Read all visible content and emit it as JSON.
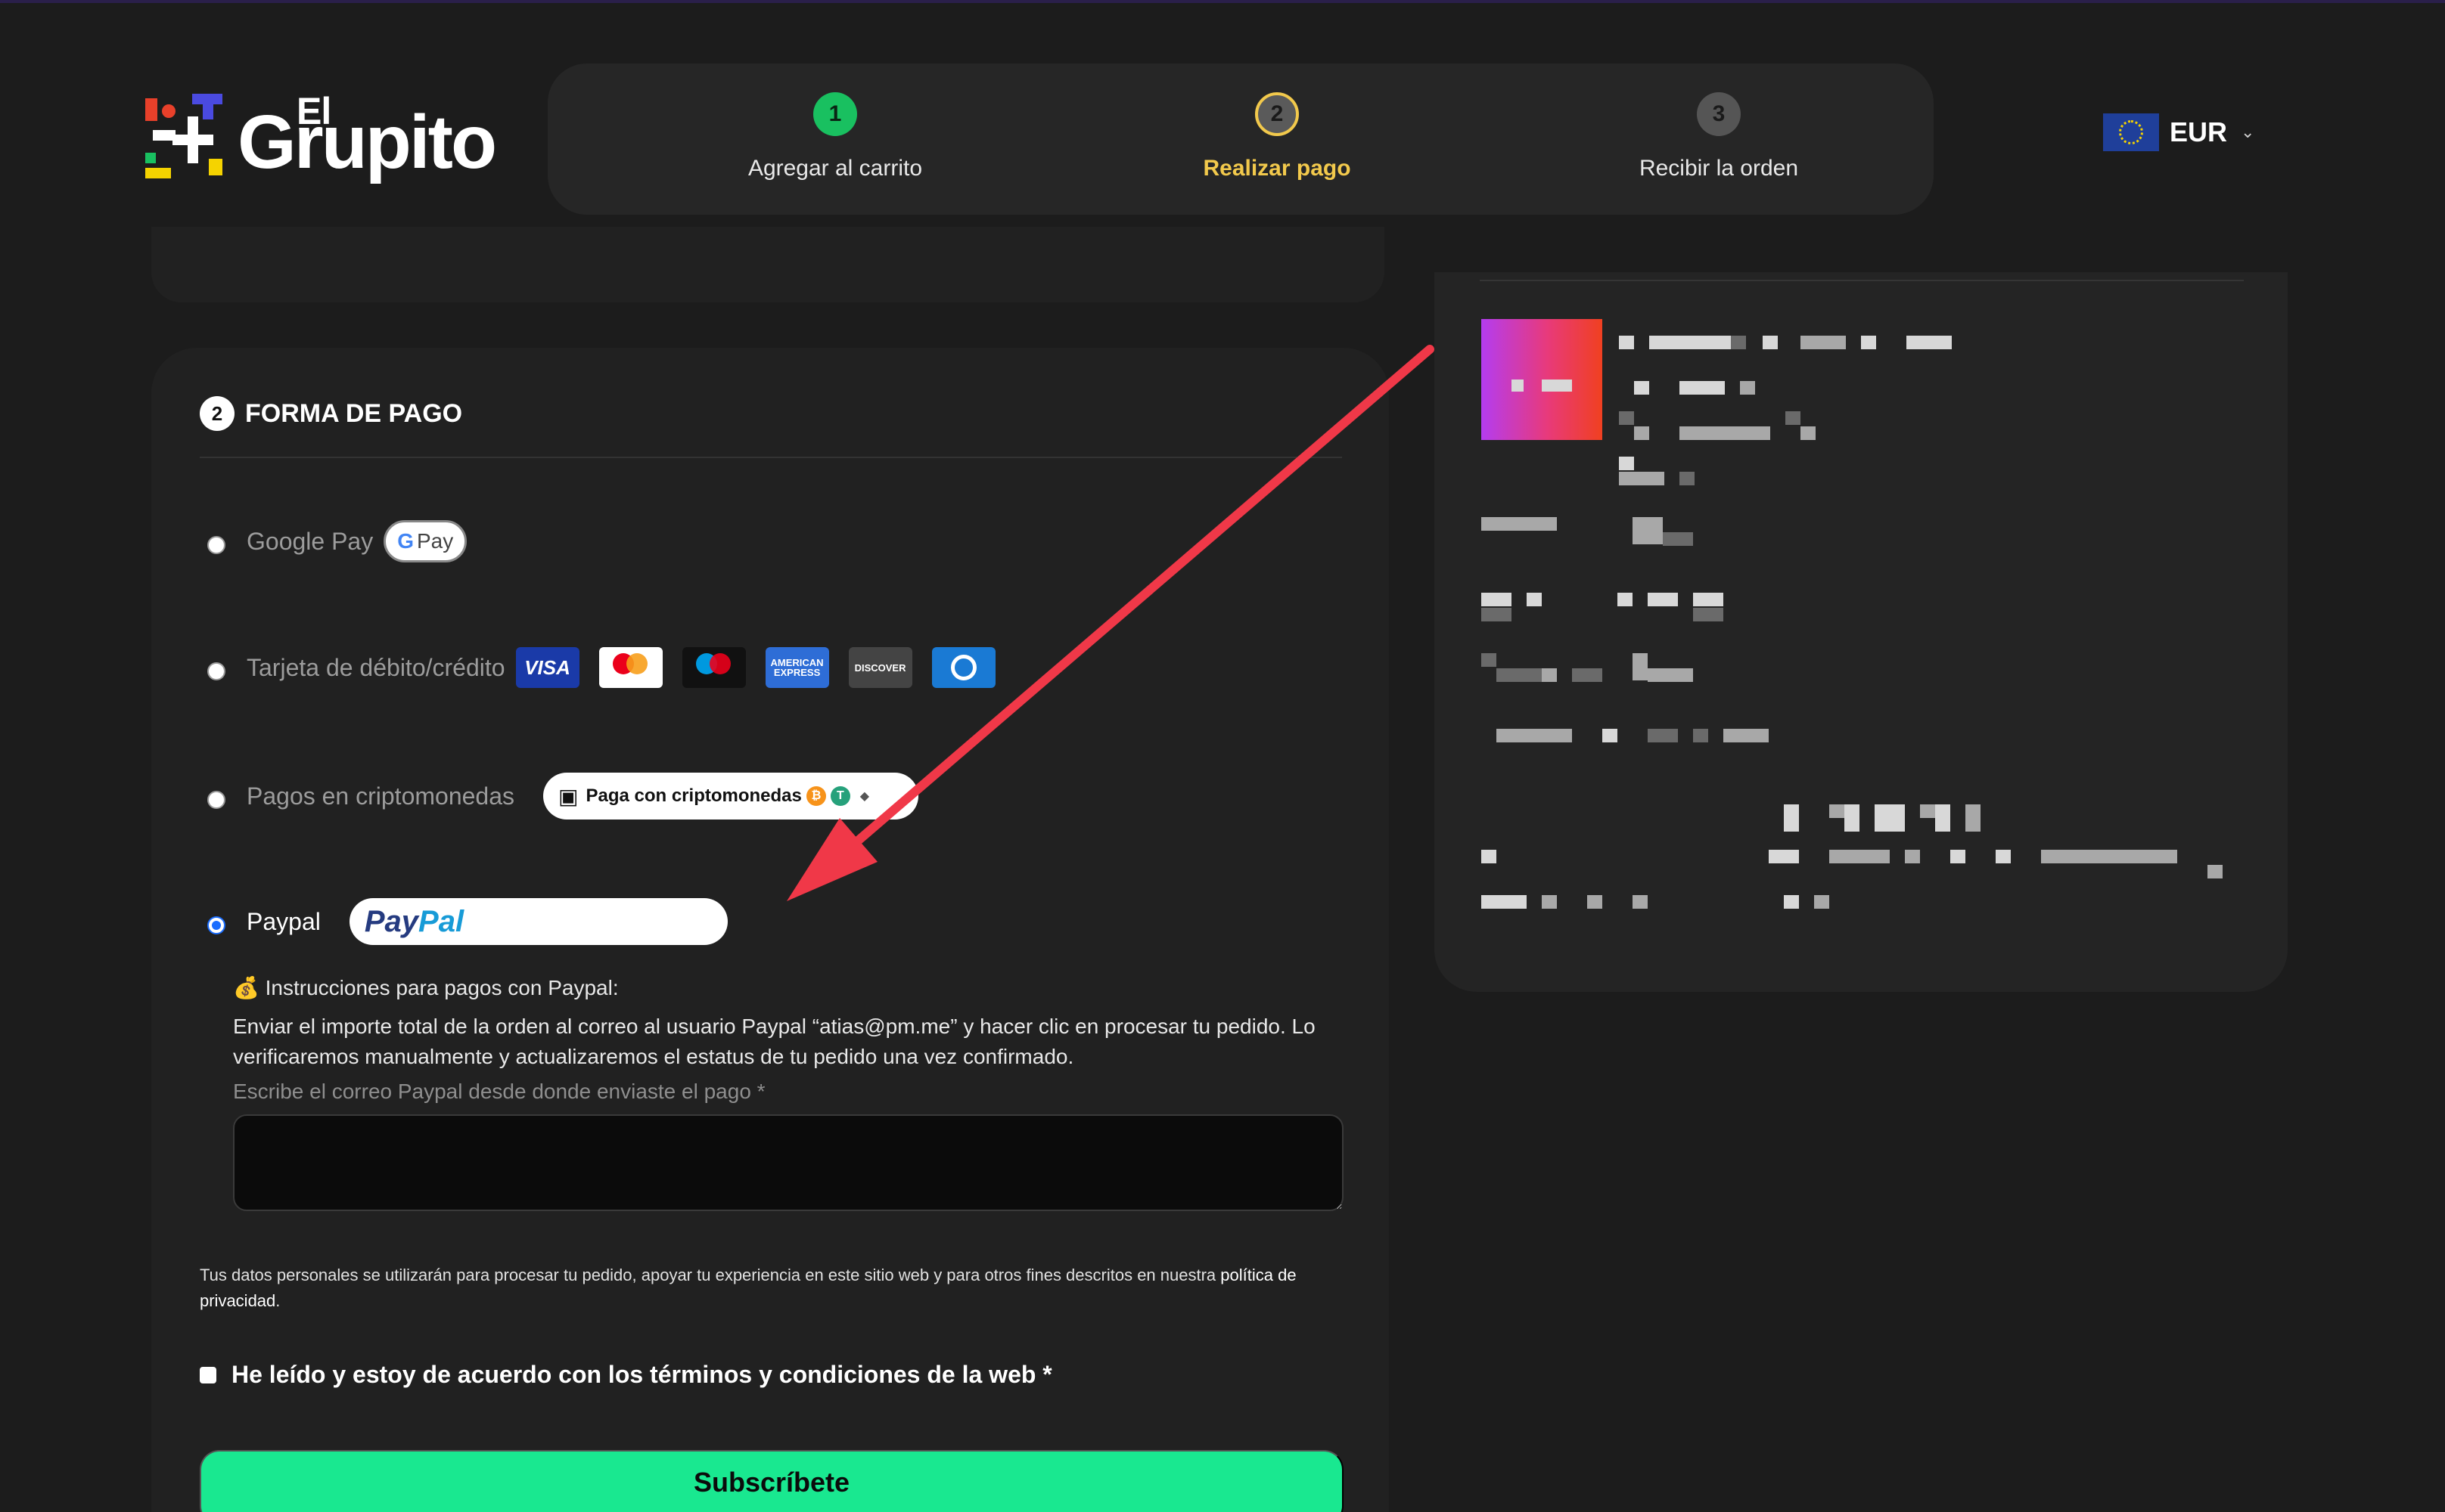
{
  "brand": {
    "logo_top": "El",
    "logo_main": "Grupito"
  },
  "stepper": {
    "steps": [
      {
        "number": "1",
        "label": "Agregar al carrito",
        "state": "done"
      },
      {
        "number": "2",
        "label": "Realizar pago",
        "state": "active"
      },
      {
        "number": "3",
        "label": "Recibir la orden",
        "state": "todo"
      }
    ]
  },
  "currency": {
    "code": "EUR",
    "flag_icon": "eu-flag-icon"
  },
  "payment": {
    "section_number": "2",
    "section_title": "FORMA DE PAGO",
    "methods": [
      {
        "label": "Google Pay",
        "selected": false,
        "badge": "Pay"
      },
      {
        "label": "Tarjeta de débito/crédito",
        "selected": false,
        "cards": [
          "VISA",
          "mastercard",
          "maestro",
          "AMERICAN EXPRESS",
          "DISCOVER",
          "diners-club"
        ]
      },
      {
        "label": "Pagos en criptomonedas",
        "selected": false,
        "badge": "Paga con criptomonedas"
      },
      {
        "label": "Paypal",
        "selected": true,
        "badge_part1": "Pay",
        "badge_part2": "Pal"
      }
    ],
    "instructions_title": "💰 Instrucciones para pagos con Paypal:",
    "instructions_body": "Enviar el importe total de la orden al correo al usuario Paypal “atias@pm.me” y hacer clic en procesar tu pedido. Lo verificaremos manualmente y actualizaremos el estatus de tu pedido una vez confirmado.",
    "email_label": "Escribe el correo Paypal desde donde enviaste el pago *",
    "email_value": ""
  },
  "privacy": {
    "text": "Tus datos personales se utilizarán para procesar tu pedido, apoyar tu experiencia en este sitio web y para otros fines descritos en nuestra ",
    "link": "política de privacidad",
    "end": "."
  },
  "terms": {
    "label": "He leído y estoy de acuerdo con los términos y condiciones de la web *",
    "checked": false
  },
  "submit": {
    "label": "Subscríbete",
    "color": "#19e890"
  },
  "colors": {
    "background": "#1c1c1c",
    "card": "#212121",
    "accent_yellow": "#f2c94c",
    "step_done": "#19c060",
    "annotation_arrow": "#f03848"
  }
}
